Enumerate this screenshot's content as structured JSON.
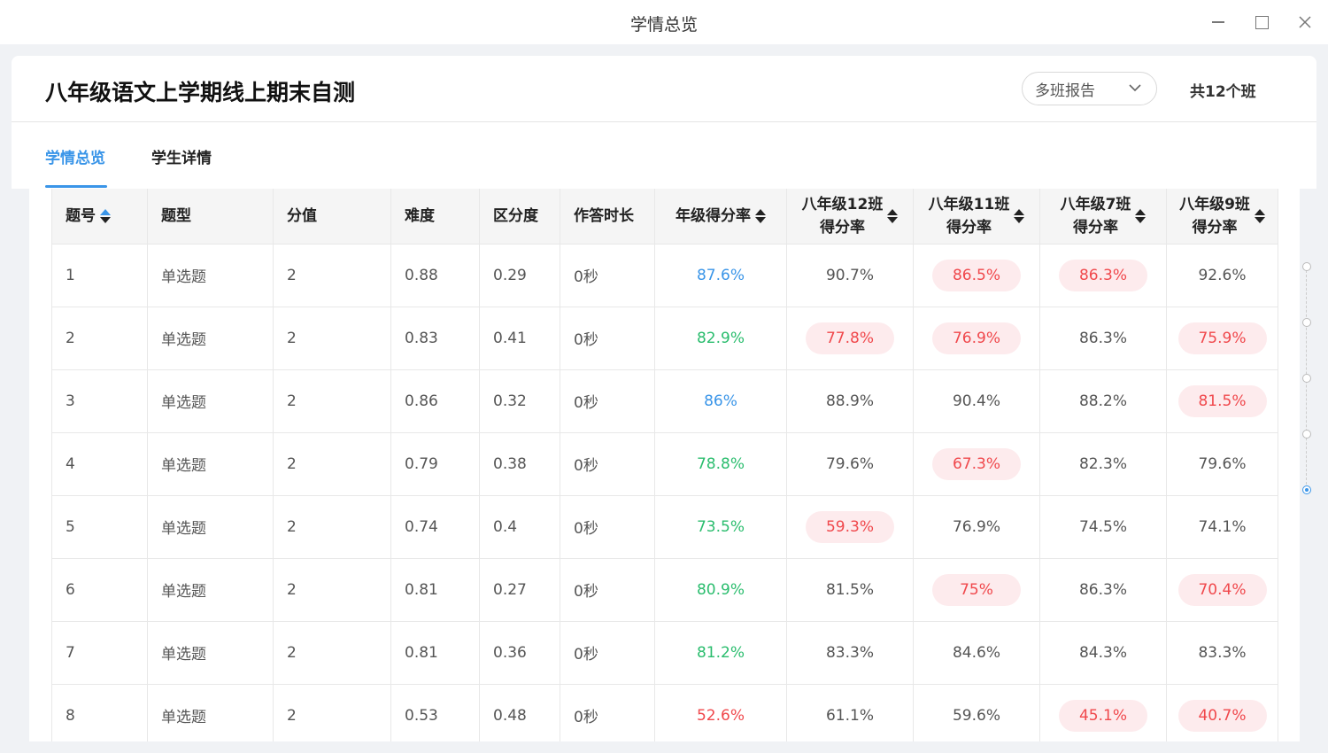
{
  "window": {
    "title": "学情总览"
  },
  "header": {
    "exam_title": "八年级语文上学期线上期末自测",
    "report_select": "多班报告",
    "class_count": "共12个班"
  },
  "tabs": [
    {
      "label": "学情总览",
      "active": true
    },
    {
      "label": "学生详情",
      "active": false
    }
  ],
  "table": {
    "columns": {
      "no": "题号",
      "type": "题型",
      "score": "分值",
      "difficulty": "难度",
      "discrimination": "区分度",
      "duration": "作答时长",
      "grade_rate": "年级得分率",
      "class12_l1": "八年级12班",
      "class12_l2": "得分率",
      "class11_l1": "八年级11班",
      "class11_l2": "得分率",
      "class7_l1": "八年级7班",
      "class7_l2": "得分率",
      "class9_l1": "八年级9班",
      "class9_l2": "得分率"
    },
    "rows": [
      {
        "no": "1",
        "type": "单选题",
        "score": "2",
        "difficulty": "0.88",
        "discrimination": "0.29",
        "duration": "0秒",
        "grade_rate": "87.6%",
        "grade_tone": "blue",
        "classes": [
          {
            "v": "90.7%",
            "low": false
          },
          {
            "v": "86.5%",
            "low": true
          },
          {
            "v": "86.3%",
            "low": true
          },
          {
            "v": "92.6%",
            "low": false
          }
        ]
      },
      {
        "no": "2",
        "type": "单选题",
        "score": "2",
        "difficulty": "0.83",
        "discrimination": "0.41",
        "duration": "0秒",
        "grade_rate": "82.9%",
        "grade_tone": "green",
        "classes": [
          {
            "v": "77.8%",
            "low": true
          },
          {
            "v": "76.9%",
            "low": true
          },
          {
            "v": "86.3%",
            "low": false
          },
          {
            "v": "75.9%",
            "low": true
          }
        ]
      },
      {
        "no": "3",
        "type": "单选题",
        "score": "2",
        "difficulty": "0.86",
        "discrimination": "0.32",
        "duration": "0秒",
        "grade_rate": "86%",
        "grade_tone": "blue",
        "classes": [
          {
            "v": "88.9%",
            "low": false
          },
          {
            "v": "90.4%",
            "low": false
          },
          {
            "v": "88.2%",
            "low": false
          },
          {
            "v": "81.5%",
            "low": true
          }
        ]
      },
      {
        "no": "4",
        "type": "单选题",
        "score": "2",
        "difficulty": "0.79",
        "discrimination": "0.38",
        "duration": "0秒",
        "grade_rate": "78.8%",
        "grade_tone": "green",
        "classes": [
          {
            "v": "79.6%",
            "low": false
          },
          {
            "v": "67.3%",
            "low": true
          },
          {
            "v": "82.3%",
            "low": false
          },
          {
            "v": "79.6%",
            "low": false
          }
        ]
      },
      {
        "no": "5",
        "type": "单选题",
        "score": "2",
        "difficulty": "0.74",
        "discrimination": "0.4",
        "duration": "0秒",
        "grade_rate": "73.5%",
        "grade_tone": "green",
        "classes": [
          {
            "v": "59.3%",
            "low": true
          },
          {
            "v": "76.9%",
            "low": false
          },
          {
            "v": "74.5%",
            "low": false
          },
          {
            "v": "74.1%",
            "low": false
          }
        ]
      },
      {
        "no": "6",
        "type": "单选题",
        "score": "2",
        "difficulty": "0.81",
        "discrimination": "0.27",
        "duration": "0秒",
        "grade_rate": "80.9%",
        "grade_tone": "green",
        "classes": [
          {
            "v": "81.5%",
            "low": false
          },
          {
            "v": "75%",
            "low": true
          },
          {
            "v": "86.3%",
            "low": false
          },
          {
            "v": "70.4%",
            "low": true
          }
        ]
      },
      {
        "no": "7",
        "type": "单选题",
        "score": "2",
        "difficulty": "0.81",
        "discrimination": "0.36",
        "duration": "0秒",
        "grade_rate": "81.2%",
        "grade_tone": "green",
        "classes": [
          {
            "v": "83.3%",
            "low": false
          },
          {
            "v": "84.6%",
            "low": false
          },
          {
            "v": "84.3%",
            "low": false
          },
          {
            "v": "83.3%",
            "low": false
          }
        ]
      },
      {
        "no": "8",
        "type": "单选题",
        "score": "2",
        "difficulty": "0.53",
        "discrimination": "0.48",
        "duration": "0秒",
        "grade_rate": "52.6%",
        "grade_tone": "red",
        "classes": [
          {
            "v": "61.1%",
            "low": false
          },
          {
            "v": "59.6%",
            "low": false
          },
          {
            "v": "45.1%",
            "low": true
          },
          {
            "v": "40.7%",
            "low": true
          }
        ]
      }
    ]
  },
  "section_nav": {
    "dots": 5,
    "active_index": 4
  },
  "colors": {
    "accent": "#3a95e8",
    "good": "#2bbd6e",
    "bad": "#f0484c",
    "bad_bg": "#fdebed"
  }
}
